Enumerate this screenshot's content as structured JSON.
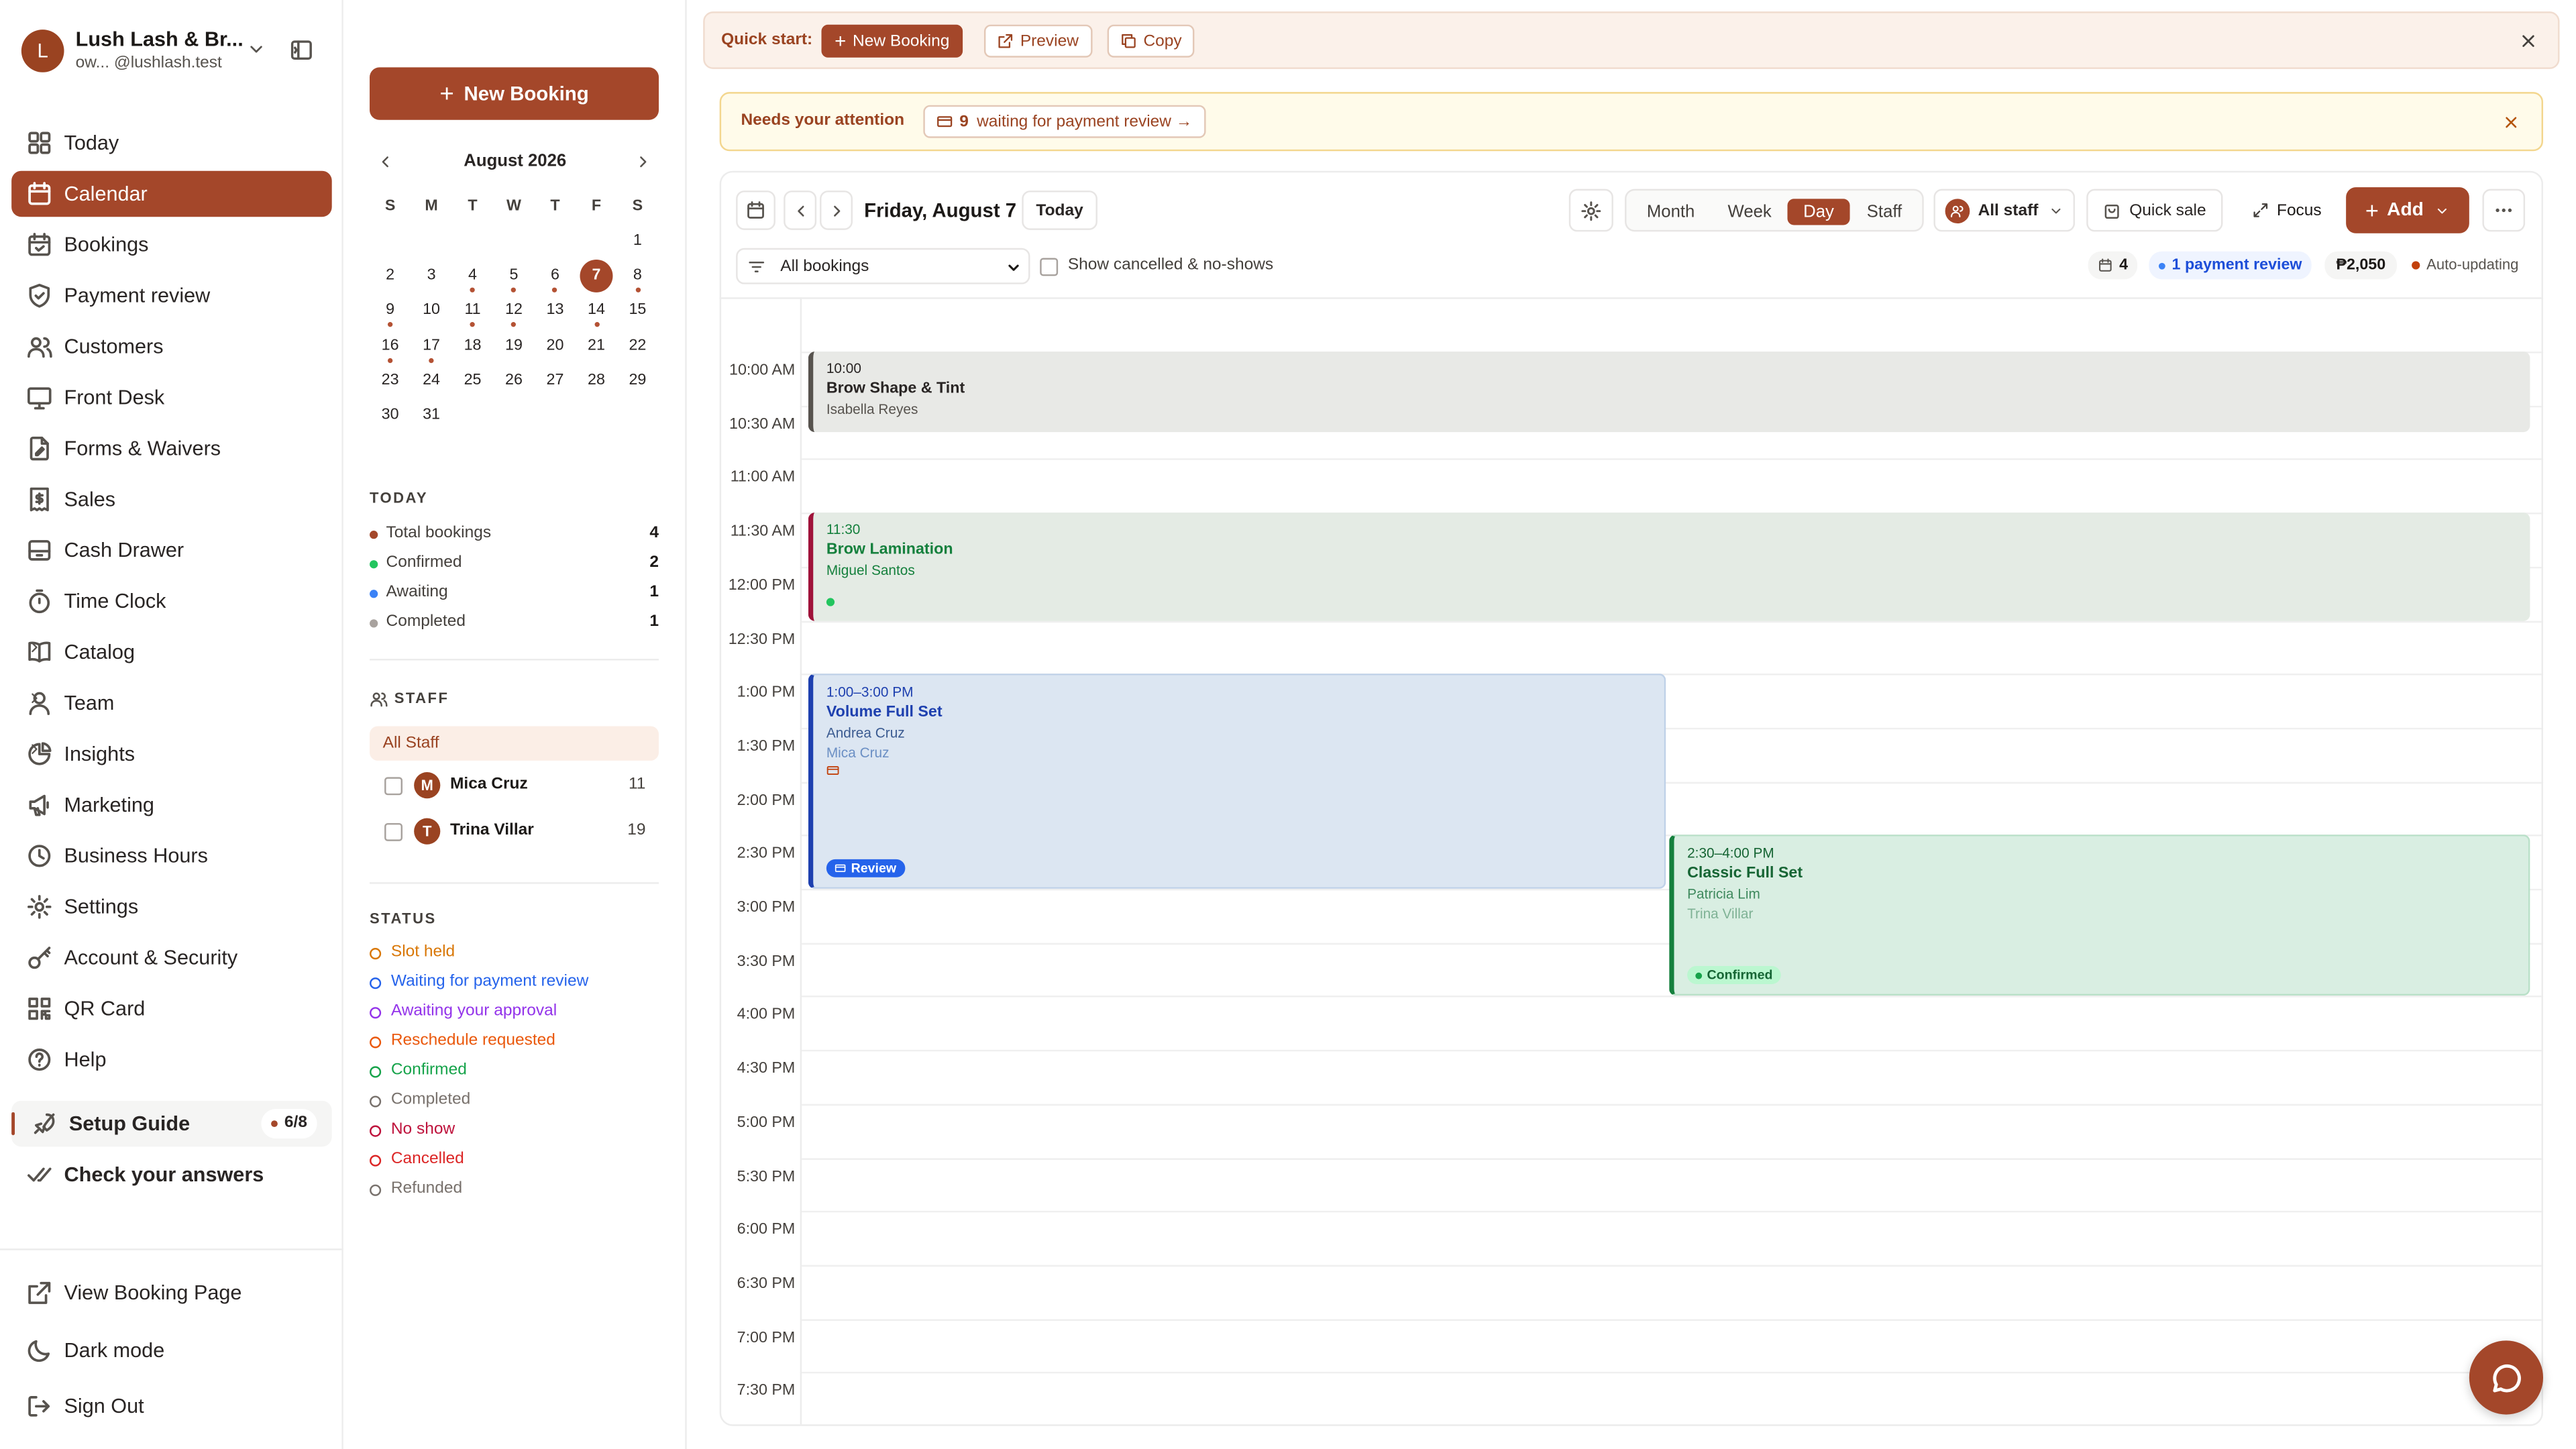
{
  "workspace": {
    "avatar": "L",
    "name": "Lush Lash & Br...",
    "email_prefix": "ow...",
    "email": "@lushlash.test"
  },
  "nav": [
    {
      "label": "Today",
      "icon": "grid-icon"
    },
    {
      "label": "Calendar",
      "icon": "calendar-icon",
      "active": true
    },
    {
      "label": "Bookings",
      "icon": "calendar-check-icon"
    },
    {
      "label": "Payment review",
      "icon": "shield-icon"
    },
    {
      "label": "Customers",
      "icon": "users-icon"
    },
    {
      "label": "Front Desk",
      "icon": "monitor-icon"
    },
    {
      "label": "Forms & Waivers",
      "icon": "file-edit-icon"
    },
    {
      "label": "Sales",
      "icon": "receipt-icon"
    },
    {
      "label": "Cash Drawer",
      "icon": "drawer-icon"
    },
    {
      "label": "Time Clock",
      "icon": "stopwatch-icon"
    },
    {
      "label": "Catalog",
      "icon": "book-icon",
      "chevron": true
    },
    {
      "label": "Team",
      "icon": "team-icon",
      "chevron": true
    },
    {
      "label": "Insights",
      "icon": "pie-chart-icon",
      "chevron": true
    },
    {
      "label": "Marketing",
      "icon": "megaphone-icon"
    },
    {
      "label": "Business Hours",
      "icon": "clock-icon"
    },
    {
      "label": "Settings",
      "icon": "gear-icon"
    },
    {
      "label": "Account & Security",
      "icon": "key-icon"
    },
    {
      "label": "QR Card",
      "icon": "qr-icon"
    },
    {
      "label": "Help",
      "icon": "help-icon"
    }
  ],
  "setup_guide": {
    "label": "Setup Guide",
    "progress": "6/8"
  },
  "check_answers": "Check your answers",
  "footer_nav": [
    {
      "label": "View Booking Page",
      "icon": "external-link-icon"
    },
    {
      "label": "Dark mode",
      "icon": "moon-icon"
    },
    {
      "label": "Sign Out",
      "icon": "sign-out-icon"
    }
  ],
  "panel": {
    "new_booking": "New Booking",
    "month_label": "August 2026",
    "weekdays": [
      "S",
      "M",
      "T",
      "W",
      "T",
      "F",
      "S"
    ],
    "weeks": [
      [
        "",
        "",
        "",
        "",
        "",
        "",
        "1"
      ],
      [
        "2",
        "3",
        "4",
        "5",
        "6",
        "7",
        "8"
      ],
      [
        "9",
        "10",
        "11",
        "12",
        "13",
        "14",
        "15"
      ],
      [
        "16",
        "17",
        "18",
        "19",
        "20",
        "21",
        "22"
      ],
      [
        "23",
        "24",
        "25",
        "26",
        "27",
        "28",
        "29"
      ],
      [
        "30",
        "31",
        "",
        "",
        "",
        "",
        ""
      ]
    ],
    "selected_day": "7",
    "dot_days": [
      "4",
      "5",
      "6",
      "8",
      "9",
      "11",
      "12",
      "14",
      "16",
      "17"
    ],
    "today_title": "TODAY",
    "today_stats": [
      {
        "label": "Total bookings",
        "value": "4",
        "color": "#a4472a"
      },
      {
        "label": "Confirmed",
        "value": "2",
        "color": "#22c55e"
      },
      {
        "label": "Awaiting",
        "value": "1",
        "color": "#3b82f6"
      },
      {
        "label": "Completed",
        "value": "1",
        "color": "#a8a29e"
      }
    ],
    "staff_title": "STAFF",
    "all_staff": "All Staff",
    "staff": [
      {
        "initial": "M",
        "name": "Mica Cruz",
        "count": "11"
      },
      {
        "initial": "T",
        "name": "Trina Villar",
        "count": "19"
      }
    ],
    "status_title": "STATUS",
    "statuses": [
      {
        "label": "Slot held",
        "color": "#d97706"
      },
      {
        "label": "Waiting for payment review",
        "color": "#2563eb"
      },
      {
        "label": "Awaiting your approval",
        "color": "#9333ea"
      },
      {
        "label": "Reschedule requested",
        "color": "#ea580c"
      },
      {
        "label": "Confirmed",
        "color": "#16a34a"
      },
      {
        "label": "Completed",
        "color": "#78716c"
      },
      {
        "label": "No show",
        "color": "#be123c"
      },
      {
        "label": "Cancelled",
        "color": "#dc2626"
      },
      {
        "label": "Refunded",
        "color": "#78716c"
      }
    ]
  },
  "quick_start": {
    "label": "Quick start:",
    "new_booking": "New Booking",
    "preview": "Preview",
    "copy": "Copy"
  },
  "attention": {
    "label": "Needs your attention",
    "count": "9",
    "text": "waiting for payment review →"
  },
  "toolbar": {
    "date": "Friday, August 7",
    "today": "Today",
    "views": [
      "Month",
      "Week",
      "Day",
      "Staff"
    ],
    "active_view": "Day",
    "all_staff": "All staff",
    "quick_sale": "Quick sale",
    "focus": "Focus",
    "add": "Add",
    "filter": "All bookings",
    "show_cancelled": "Show cancelled & no-shows",
    "count": "4",
    "payment_review": "1 payment review",
    "revenue": "₱2,050",
    "auto": "Auto-updating"
  },
  "time_labels": [
    "10:00 AM",
    "10:30 AM",
    "11:00 AM",
    "11:30 AM",
    "12:00 PM",
    "12:30 PM",
    "1:00 PM",
    "1:30 PM",
    "2:00 PM",
    "2:30 PM",
    "3:00 PM",
    "3:30 PM",
    "4:00 PM",
    "4:30 PM",
    "5:00 PM",
    "5:30 PM",
    "6:00 PM",
    "6:30 PM",
    "7:00 PM",
    "7:30 PM"
  ],
  "events": [
    {
      "time": "10:00",
      "title": "Brow Shape & Tint",
      "customer": "Isabella Reyes",
      "staff": ""
    },
    {
      "time": "11:30",
      "title": "Brow Lamination",
      "customer": "Miguel Santos",
      "staff": ""
    },
    {
      "time": "1:00–3:00 PM",
      "title": "Volume Full Set",
      "customer": "Andrea Cruz",
      "staff": "Mica Cruz",
      "badge": "Review"
    },
    {
      "time": "2:30–4:00 PM",
      "title": "Classic Full Set",
      "customer": "Patricia Lim",
      "staff": "Trina Villar",
      "badge": "Confirmed"
    }
  ]
}
